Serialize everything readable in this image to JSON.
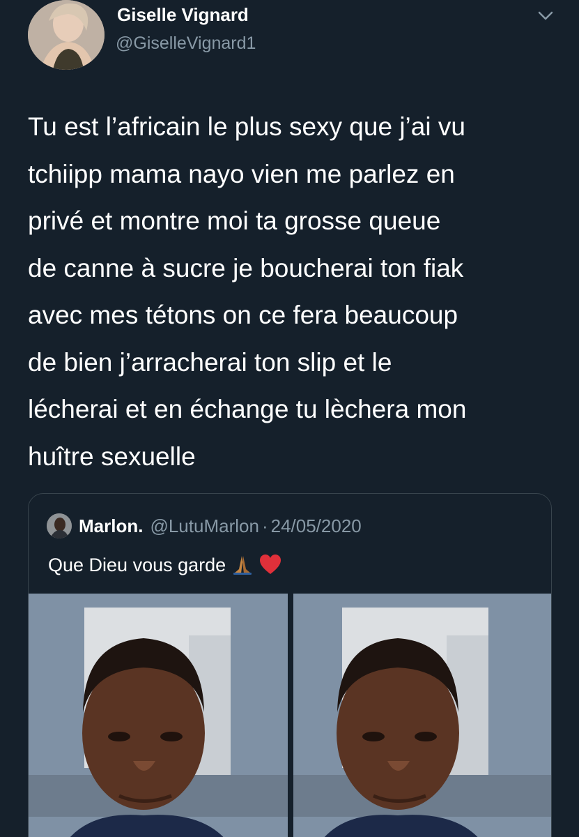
{
  "tweet": {
    "author_name": "Giselle Vignard",
    "author_handle": "@GiselleVignard1",
    "text": "Tu est l’africain le plus sexy que j’ai vu\ntchiipp mama nayo vien me parlez en\nprivé et montre moi ta grosse queue\nde canne à sucre je boucherai ton fiak\navec mes tétons on ce fera beaucoup\nde bien j’arracherai ton slip et le\nlécherai et en échange tu lèchera mon\nhuître sexuelle"
  },
  "quoted_tweet": {
    "author_name": "Marlon.",
    "author_handle": "@LutuMarlon",
    "separator": "·",
    "date": "24/05/2020",
    "text": "Que Dieu vous garde",
    "emojis": [
      "folded-hands-icon",
      "red-heart-icon"
    ],
    "media": [
      {
        "name": "photo-1",
        "alt_icon": "selfie-photo"
      },
      {
        "name": "photo-2",
        "alt_icon": "selfie-photo"
      }
    ]
  },
  "icons": {
    "caret": "chevron-down-icon"
  },
  "colors": {
    "background": "#15202b",
    "primary_text": "#ffffff",
    "secondary_text": "#8899a6",
    "border": "#38444d"
  }
}
